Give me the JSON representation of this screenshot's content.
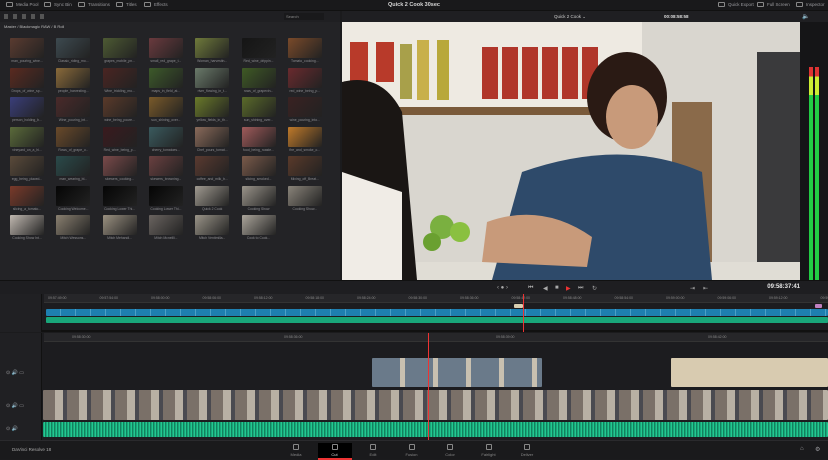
{
  "topbar": {
    "left_items": [
      "Media Pool",
      "Sync Bin",
      "Transitions",
      "Titles",
      "Effects"
    ],
    "title": "Quick 2 Cook 30sec",
    "right_items": [
      "Quick Export",
      "Full Screen",
      "Inspector"
    ]
  },
  "media_pool": {
    "search_placeholder": "Search",
    "breadcrumb": "Master / Blackmagic RAW / B Roll",
    "clips": [
      {
        "name": "man_pouring_wine...",
        "color": "#5a3b30"
      },
      {
        "name": "Classic_riding_mo...",
        "color": "#3d4a50"
      },
      {
        "name": "grapes_mobile_pn...",
        "color": "#4d5a33"
      },
      {
        "name": "small_red_grape_t...",
        "color": "#6a3a3e"
      },
      {
        "name": "Woman_harvestin...",
        "color": "#6f7a3b"
      },
      {
        "name": "Red_wine_drippin...",
        "color": "#151515"
      },
      {
        "name": "Tomato_cooking...",
        "color": "#7a4a2a"
      },
      {
        "name": "Drops_of_wine_sp...",
        "color": "#5a2a20"
      },
      {
        "name": "people_harvesting...",
        "color": "#8a6a3a"
      },
      {
        "name": "Wine_trickling_mo...",
        "color": "#4a2522"
      },
      {
        "name": "maps_in_field_at...",
        "color": "#3d5a2a"
      },
      {
        "name": "river_flowing_in_t...",
        "color": "#6a7a6a"
      },
      {
        "name": "rows_of_grapevin...",
        "color": "#3f5a25"
      },
      {
        "name": "red_wine_being_p...",
        "color": "#6a2a2e"
      },
      {
        "name": "person_holding_b...",
        "color": "#3a3e7a"
      },
      {
        "name": "Wine_pouring_int...",
        "color": "#4a2a2a"
      },
      {
        "name": "wine_being_poure...",
        "color": "#5a3a2a"
      },
      {
        "name": "sun_shining_over...",
        "color": "#7a5a2a"
      },
      {
        "name": "yellow_fields_in_th...",
        "color": "#6a7a2a"
      },
      {
        "name": "sun_shining_over...",
        "color": "#5a6a2a"
      },
      {
        "name": "wine_pouring_into...",
        "color": "#3a2222"
      },
      {
        "name": "vineyard_on_a_hi...",
        "color": "#5a6a3a"
      },
      {
        "name": "Rows_of_grape_v...",
        "color": "#6a4a2a"
      },
      {
        "name": "Red_wine_being_p...",
        "color": "#3a1a1e"
      },
      {
        "name": "cherry_tomatoes...",
        "color": "#3a5a5e"
      },
      {
        "name": "Chef_pours_tomat...",
        "color": "#8a6a5a"
      },
      {
        "name": "food_being_roaste...",
        "color": "#a05a5a"
      },
      {
        "name": "fire_and_smoke_o...",
        "color": "#c07a2a"
      },
      {
        "name": "egg_being_placed...",
        "color": "#5a4a3a"
      },
      {
        "name": "man_wearing_bl...",
        "color": "#2a4a4a"
      },
      {
        "name": "skewers_cooking...",
        "color": "#7a4a4a"
      },
      {
        "name": "skewers_browning...",
        "color": "#6a4040"
      },
      {
        "name": "coffee_and_milk_b...",
        "color": "#5a3a30"
      },
      {
        "name": "slicing_smoked...",
        "color": "#7a5a4a"
      },
      {
        "name": "Mixing_off_Breat...",
        "color": "#5a3a2a"
      },
      {
        "name": "slicing_a_tomato...",
        "color": "#7a3a2a"
      },
      {
        "name": "Cooking Welcome...",
        "color": "#050505"
      },
      {
        "name": "Cooking Lower Thi...",
        "color": "#050505"
      },
      {
        "name": "Cooking Lower Thi...",
        "color": "#050505"
      },
      {
        "name": "Quick 2 Cook",
        "color": "#a09a90"
      },
      {
        "name": "Cooking Show",
        "color": "#9a948a"
      },
      {
        "name": "Cooking Show...",
        "color": "#8a847a"
      },
      {
        "name": "Cooking Show Int...",
        "color": "#c0b8b0"
      },
      {
        "name": "Mitch Wessons...",
        "color": "#8a8070"
      },
      {
        "name": "Mitch Mehandi...",
        "color": "#9a9080"
      },
      {
        "name": "Mitch Mcneilli...",
        "color": "#6a6460"
      },
      {
        "name": "Mitch Ventimilla...",
        "color": "#9a9488"
      },
      {
        "name": "Cook to Cook...",
        "color": "#aaa49a"
      }
    ]
  },
  "viewer": {
    "clip_name": "Quick 2 Cook ⌄",
    "timecode": "00:08:58:58"
  },
  "transport": {
    "timecode": "09:58:37:41"
  },
  "timeline_upper": {
    "ruler": [
      "09:57:49:00",
      "09:57:54:00",
      "09:58:00:00",
      "09:58:06:00",
      "09:58:12:00",
      "09:58:18:00",
      "09:58:24:00",
      "09:58:30:00",
      "09:58:36:00",
      "09:58:42:00",
      "09:58:48:00",
      "09:58:54:00",
      "09:59:00:00",
      "09:59:06:00",
      "09:59:12:00",
      "09:59:18:00"
    ],
    "playhead_pct": 61
  },
  "timeline_lower": {
    "ruler": [
      "09:58:30:00",
      "09:58:36:00",
      "09:58:39:00",
      "09:58:42:00"
    ],
    "tracks": [
      "V2",
      "V1",
      "A1"
    ],
    "playhead_pct": 49
  },
  "bottombar": {
    "app": "DaVinci Resolve 18",
    "pages": [
      "Media",
      "Cut",
      "Edit",
      "Fusion",
      "Color",
      "Fairlight",
      "Deliver"
    ],
    "active_page": "Cut"
  },
  "colors": {
    "accent": "#e33a3a",
    "clip_blue": "#1e7fb0",
    "audio_green": "#19a67a"
  }
}
